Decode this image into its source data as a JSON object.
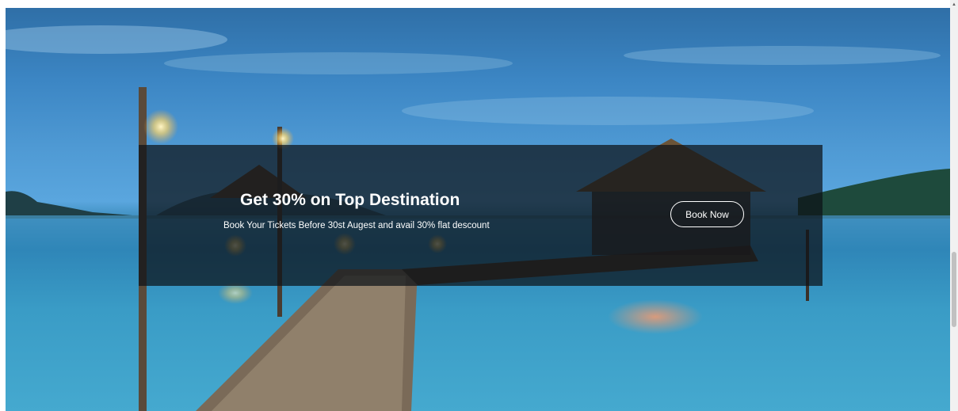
{
  "hero": {
    "background_image": "tropical-pier-at-dusk"
  },
  "banner": {
    "title": "Get 30% on Top Destination",
    "subtitle": "Book Your Tickets Before 30st Augest and avail 30% flat descount",
    "button_label": "Book Now"
  },
  "scrollbar": {
    "up_arrow_icon": "triangle-up-icon"
  }
}
